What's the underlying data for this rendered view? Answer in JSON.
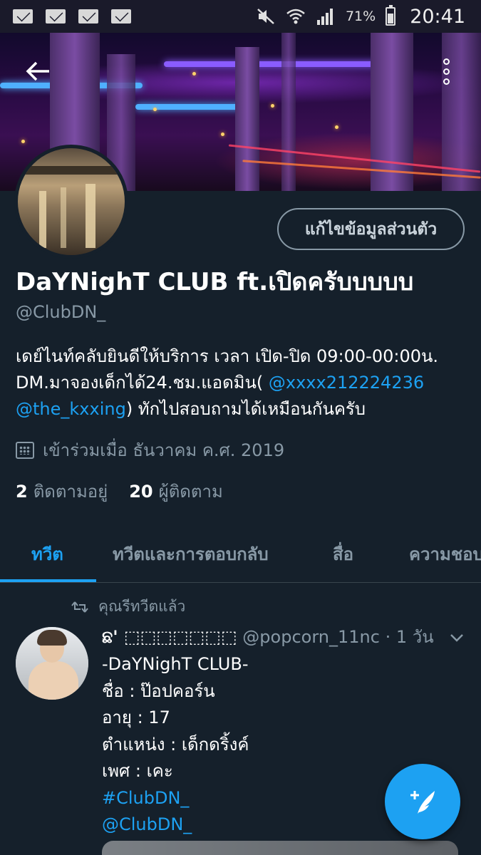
{
  "status_bar": {
    "notifications": [
      "mail-icon",
      "mail-icon",
      "mail-icon",
      "mail-icon"
    ],
    "battery_percent": "71%",
    "time": "20:41",
    "icons": [
      "mute-icon",
      "wifi-icon",
      "signal-icon",
      "battery-icon"
    ]
  },
  "header": {
    "back_icon": "arrow-left-icon",
    "more_icon": "more-vertical-icon"
  },
  "profile": {
    "edit_button": "แก้ไขข้อมูลส่วนตัว",
    "display_name": "DaYNighT CLUB ft.เปิดครับบบบบ",
    "handle": "@ClubDN_",
    "bio": {
      "line1": "เดย์ไนท์คลับยินดีให้บริการ เวลา เปิด-ปิด 09:00-00:00น.",
      "line2_text": "DM.มาจองเด็กได้24.ชม.แอดมิน( ",
      "line2_link": "@xxxx212224236",
      "line3_link": "@the_kxxing",
      "line3_text": ") ทักไปสอบถามได้เหมือนกันครับ"
    },
    "joined": "เข้าร่วมเมื่อ ธันวาคม ค.ศ. 2019",
    "following_count": "2",
    "following_label": "ติดตามอยู่",
    "followers_count": "20",
    "followers_label": "ผู้ติดตาม"
  },
  "tabs": [
    {
      "label": "ทวีต",
      "active": true
    },
    {
      "label": "ทวีตและการตอบกลับ",
      "active": false
    },
    {
      "label": "สื่อ",
      "active": false
    },
    {
      "label": "ความชอบ",
      "active": false
    }
  ],
  "tweet": {
    "retweet_label": "คุณรีทวีตแล้ว",
    "author_name": "ଛ' ⬚⬚⬚⬚⬚⬚⬚",
    "author_handle": "@popcorn_11nc",
    "time": "· 1 วัน",
    "lines": [
      "-DaYNighT CLUB-",
      "ชื่อ : ป๊อปคอร์น",
      "อายุ : 17",
      "ตำแหน่ง : เด็กดริ้งค์",
      "เพศ : เคะ"
    ],
    "hashtag": "#ClubDN_",
    "mention": "@ClubDN_"
  },
  "fab": {
    "icon": "compose-tweet-icon"
  },
  "colors": {
    "background": "#15202b",
    "accent": "#1da1f2",
    "muted": "#8899a6"
  }
}
